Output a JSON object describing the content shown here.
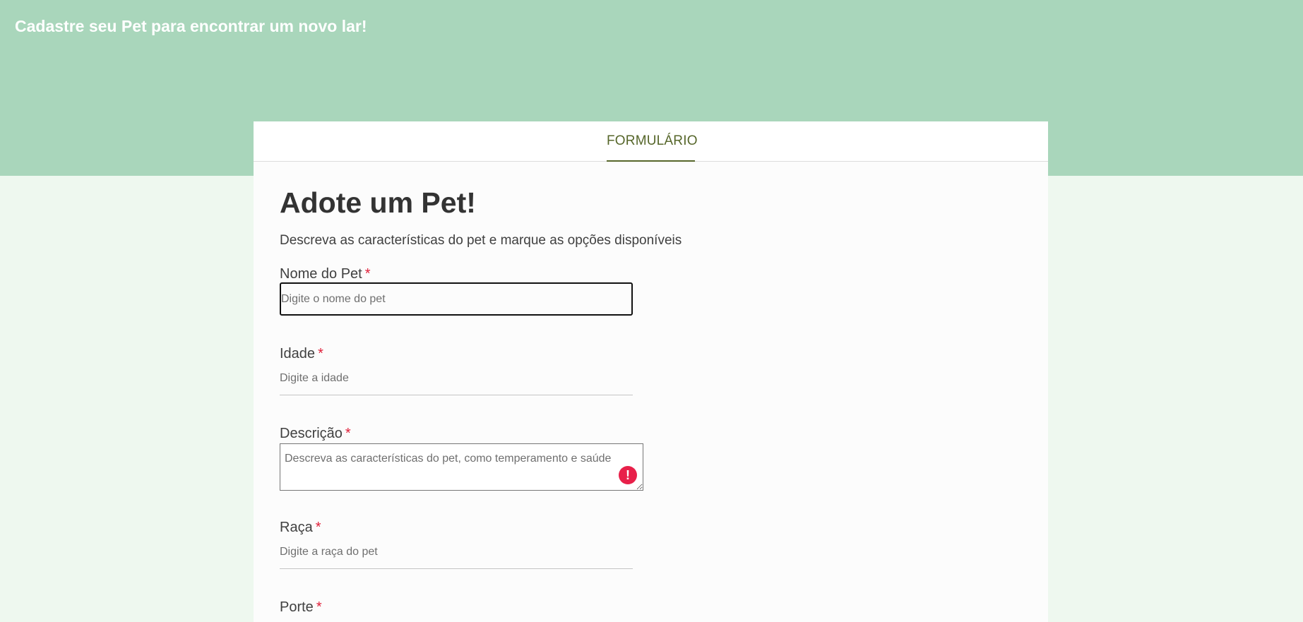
{
  "banner": {
    "title": "Cadastre seu Pet para encontrar um novo lar!"
  },
  "tabs": [
    {
      "label": "FORMULÁRIO",
      "active": true
    }
  ],
  "form": {
    "title": "Adote um Pet!",
    "subtitle": "Descreva as características do pet e marque as opções disponíveis",
    "required_marker": "*",
    "fields": {
      "name": {
        "label": "Nome do Pet",
        "placeholder": "Digite o nome do pet",
        "value": ""
      },
      "age": {
        "label": "Idade",
        "placeholder": "Digite a idade",
        "value": ""
      },
      "description": {
        "label": "Descrição",
        "placeholder": "Descreva as características do pet, como temperamento e saúde",
        "value": ""
      },
      "breed": {
        "label": "Raça",
        "placeholder": "Digite a raça do pet",
        "value": ""
      },
      "size": {
        "label": "Porte"
      }
    }
  },
  "icons": {
    "description_error": "exclamation-error-icon"
  },
  "colors": {
    "banner": "#a9d6bb",
    "page_background": "#eef8ef",
    "tab_accent": "#56662a",
    "required": "#e0203a",
    "error": "#e8204a"
  }
}
